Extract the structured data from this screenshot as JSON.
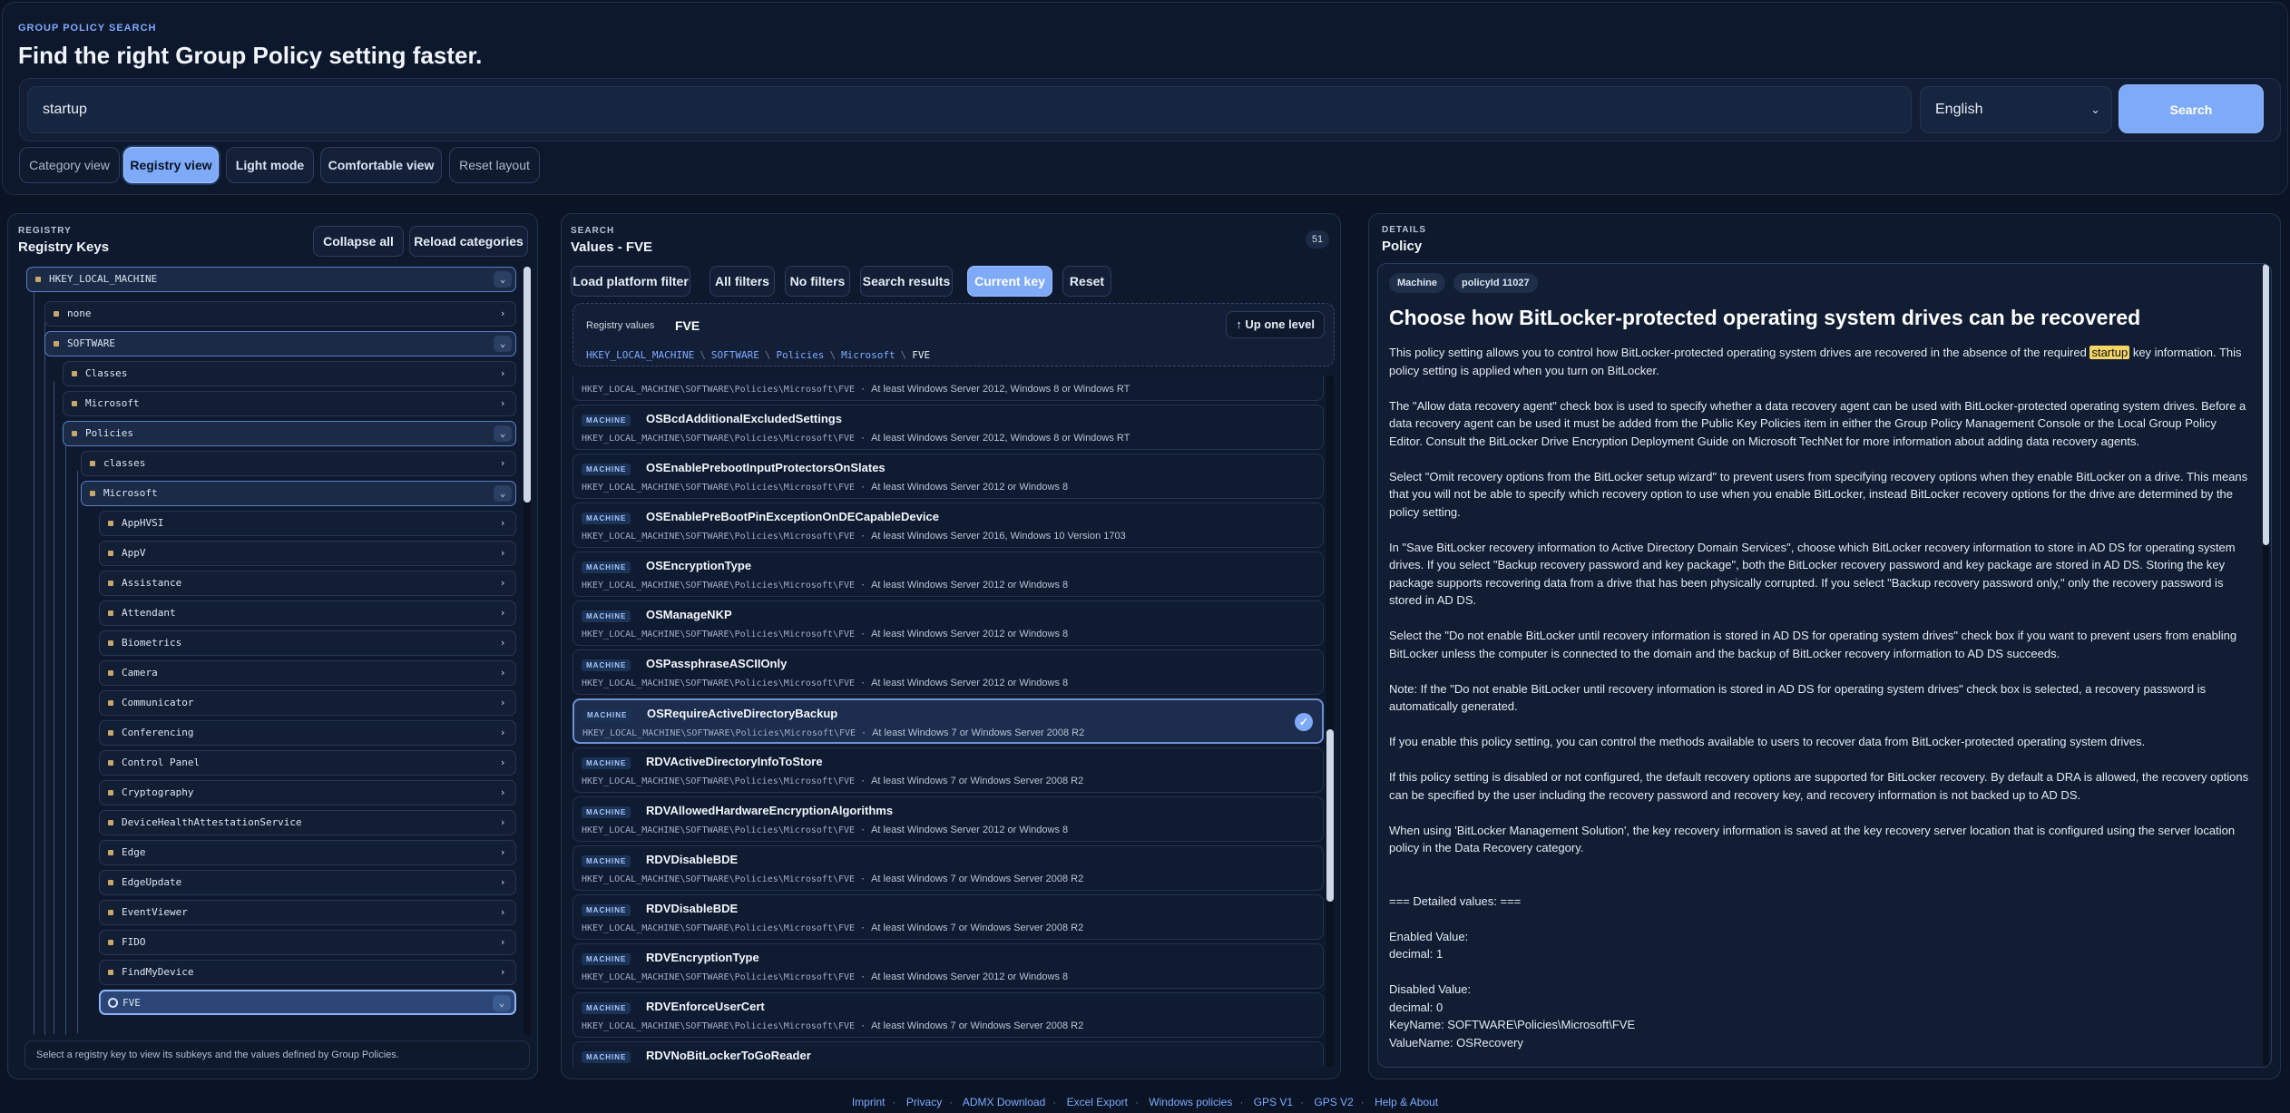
{
  "header": {
    "eyebrow": "GROUP POLICY SEARCH",
    "title": "Find the right Group Policy setting faster.",
    "search_value": "startup",
    "language": "English",
    "search_button": "Search",
    "view_buttons": [
      "Category view",
      "Registry view",
      "Light mode",
      "Comfortable view",
      "Reset layout"
    ],
    "active_view": "Registry view"
  },
  "registry": {
    "tag": "REGISTRY",
    "title": "Registry Keys",
    "collapse_all": "Collapse all",
    "reload": "Reload categories",
    "hint": "Select a registry key to view its subkeys and the values defined by Group Policies.",
    "nodes": [
      "HKEY_LOCAL_MACHINE",
      "none",
      "SOFTWARE",
      "Classes",
      "Microsoft",
      "Policies",
      "classes",
      "Microsoft",
      "AppHVSI",
      "AppV",
      "Assistance",
      "Attendant",
      "Biometrics",
      "Camera",
      "Communicator",
      "Conferencing",
      "Control Panel",
      "Cryptography",
      "DeviceHealthAttestationService",
      "Edge",
      "EdgeUpdate",
      "EventViewer",
      "FIDO",
      "FindMyDevice",
      "FVE"
    ]
  },
  "search": {
    "tag": "SEARCH",
    "title": "Values - FVE",
    "count": "51",
    "filters": [
      "Load platform filter",
      "All filters",
      "No filters",
      "Search results",
      "Current key",
      "Reset"
    ],
    "active_filter": "Current key",
    "key_label": "Registry values",
    "key_value": "FVE",
    "up_button": "↑ Up one level",
    "crumbs": [
      "HKEY_LOCAL_MACHINE",
      "SOFTWARE",
      "Policies",
      "Microsoft",
      "FVE"
    ],
    "badge": "MACHINE",
    "path": "HKEY_LOCAL_MACHINE\\SOFTWARE\\Policies\\Microsoft\\FVE",
    "partial_top_support": "At least Windows Server 2012, Windows 8 or Windows RT",
    "items": [
      {
        "name": "OSBcdAdditionalExcludedSettings",
        "support": "At least Windows Server 2012, Windows 8 or Windows RT"
      },
      {
        "name": "OSEnablePrebootInputProtectorsOnSlates",
        "support": "At least Windows Server 2012 or Windows 8"
      },
      {
        "name": "OSEnablePreBootPinExceptionOnDECapableDevice",
        "support": "At least Windows Server 2016, Windows 10 Version 1703"
      },
      {
        "name": "OSEncryptionType",
        "support": "At least Windows Server 2012 or Windows 8"
      },
      {
        "name": "OSManageNKP",
        "support": "At least Windows Server 2012 or Windows 8"
      },
      {
        "name": "OSPassphraseASCIIOnly",
        "support": "At least Windows Server 2012 or Windows 8"
      },
      {
        "name": "OSRequireActiveDirectoryBackup",
        "support": "At least Windows 7 or Windows Server 2008 R2"
      },
      {
        "name": "RDVActiveDirectoryInfoToStore",
        "support": "At least Windows 7 or Windows Server 2008 R2"
      },
      {
        "name": "RDVAllowedHardwareEncryptionAlgorithms",
        "support": "At least Windows Server 2012 or Windows 8"
      },
      {
        "name": "RDVDisableBDE",
        "support": "At least Windows 7 or Windows Server 2008 R2"
      },
      {
        "name": "RDVDisableBDE",
        "support": "At least Windows 7 or Windows Server 2008 R2"
      },
      {
        "name": "RDVEncryptionType",
        "support": "At least Windows Server 2012 or Windows 8"
      },
      {
        "name": "RDVEnforceUserCert",
        "support": "At least Windows 7 or Windows Server 2008 R2"
      },
      {
        "name": "RDVNoBitLockerToGoReader",
        "support": ""
      }
    ]
  },
  "details": {
    "tag": "DETAILS",
    "title": "Policy",
    "chip_scope": "Machine",
    "chip_id": "policyId 11027",
    "policy_title": "Choose how BitLocker-protected operating system drives can be recovered",
    "p1_before": "This policy setting allows you to control how BitLocker-protected operating system drives are recovered in the absence of the required ",
    "p1_highlight": "startup",
    "p1_after": " key information. This policy setting is applied when you turn on BitLocker.",
    "paragraphs": [
      "The \"Allow data recovery agent\" check box is used to specify whether a data recovery agent can be used with BitLocker-protected operating system drives. Before a data recovery agent can be used it must be added from the Public Key Policies item in either the Group Policy Management Console or the Local Group Policy Editor. Consult the BitLocker Drive Encryption Deployment Guide on Microsoft TechNet for more information about adding data recovery agents.",
      "Select \"Omit recovery options from the BitLocker setup wizard\" to prevent users from specifying recovery options when they enable BitLocker on a drive. This means that you will not be able to specify which recovery option to use when you enable BitLocker, instead BitLocker recovery options for the drive are determined by the policy setting.",
      "In \"Save BitLocker recovery information to Active Directory Domain Services\", choose which BitLocker recovery information to store in AD DS for operating system drives. If you select \"Backup recovery password and key package\", both the BitLocker recovery password and key package are stored in AD DS. Storing the key package supports recovering data from a drive that has been physically corrupted. If you select \"Backup recovery password only,\" only the recovery password is stored in AD DS.",
      "Select the \"Do not enable BitLocker until recovery information is stored in AD DS for operating system drives\" check box if you want to prevent users from enabling BitLocker unless the computer is connected to the domain and the backup of BitLocker recovery information to AD DS succeeds.",
      "Note: If the \"Do not enable BitLocker until recovery information is stored in AD DS for operating system drives\" check box is selected, a recovery password is automatically generated.",
      "If you enable this policy setting, you can control the methods available to users to recover data from BitLocker-protected operating system drives.",
      "If this policy setting is disabled or not configured, the default recovery options are supported for BitLocker recovery. By default a DRA is allowed, the recovery options can be specified by the user including the recovery password and recovery key, and recovery information is not backed up to AD DS.",
      "When using 'BitLocker Management Solution', the key recovery information is saved at the key recovery server location that is configured using the server location policy in the Data Recovery category."
    ],
    "detailed_header": "=== Detailed values: ===",
    "enabled_label": "Enabled Value:",
    "enabled_value": "decimal: 1",
    "disabled_label": "Disabled Value:",
    "disabled_value": "decimal: 0",
    "key_name": "KeyName: SOFTWARE\\Policies\\Microsoft\\FVE",
    "value_name": "ValueName: OSRecovery"
  },
  "footer": {
    "links": [
      "Imprint",
      "Privacy",
      "ADMX Download",
      "Excel Export",
      "Windows policies",
      "GPS V1",
      "GPS V2",
      "Help & About"
    ]
  },
  "colors": {
    "accent": "#7faaf8",
    "background": "#0b1424",
    "highlight": "#f5d565",
    "bullet": "#c9a66b"
  }
}
